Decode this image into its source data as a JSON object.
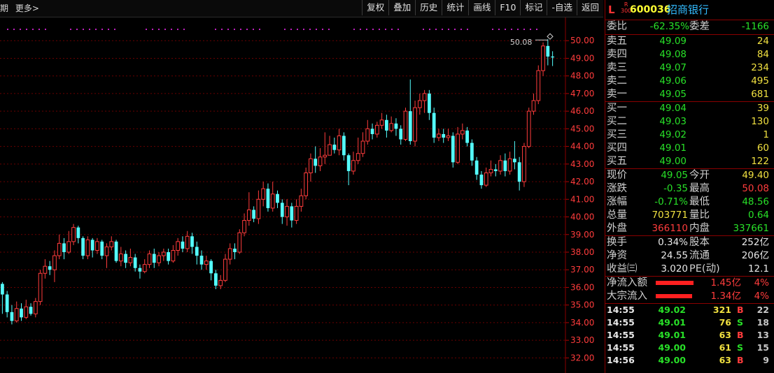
{
  "topbar": {
    "period_label": "期",
    "more_label": "更多>",
    "buttons": [
      "复权",
      "叠加",
      "历史",
      "统计",
      "画线",
      "F10",
      "标记",
      "-自选",
      "返回"
    ]
  },
  "chart_data": {
    "type": "candlestick",
    "ylim": [
      31.5,
      51.0
    ],
    "y_ticks": [
      "50.00",
      "49.00",
      "48.00",
      "47.00",
      "46.00",
      "45.00",
      "44.00",
      "43.00",
      "42.00",
      "41.00",
      "40.00",
      "39.00",
      "38.00",
      "37.00",
      "36.00",
      "35.00",
      "34.00",
      "33.00",
      "32.00"
    ],
    "annotation": "50.08",
    "up_color": "#ff3c3c",
    "down_color": "#54ffff",
    "candles": [
      [
        36.2,
        35.6,
        36.3,
        34.5
      ],
      [
        35.6,
        34.6,
        35.8,
        34.3
      ],
      [
        34.6,
        34.1,
        35.0,
        33.9
      ],
      [
        34.1,
        34.8,
        35.2,
        34.0
      ],
      [
        34.8,
        34.3,
        35.1,
        34.1
      ],
      [
        34.3,
        34.9,
        35.3,
        34.2
      ],
      [
        34.9,
        34.5,
        35.1,
        34.4
      ],
      [
        34.5,
        35.2,
        35.4,
        34.3
      ],
      [
        35.2,
        36.8,
        37.0,
        35.0
      ],
      [
        36.8,
        37.2,
        37.6,
        36.5
      ],
      [
        37.2,
        37.0,
        37.5,
        36.7
      ],
      [
        37.0,
        37.8,
        38.1,
        36.3
      ],
      [
        37.8,
        38.5,
        39.0,
        37.6
      ],
      [
        38.5,
        38.0,
        38.8,
        37.6
      ],
      [
        38.0,
        38.6,
        39.2,
        37.9
      ],
      [
        38.6,
        39.4,
        39.6,
        38.4
      ],
      [
        39.4,
        38.8,
        39.5,
        38.5
      ],
      [
        38.8,
        37.8,
        38.9,
        37.6
      ],
      [
        37.8,
        38.7,
        38.9,
        37.6
      ],
      [
        38.7,
        38.1,
        38.8,
        37.7
      ],
      [
        38.1,
        38.6,
        38.8,
        37.9
      ],
      [
        38.6,
        37.8,
        38.7,
        37.6
      ],
      [
        37.8,
        38.3,
        38.5,
        37.1
      ],
      [
        38.3,
        38.6,
        38.9,
        38.1
      ],
      [
        38.6,
        37.5,
        38.7,
        37.4
      ],
      [
        37.5,
        37.9,
        38.3,
        37.2
      ],
      [
        37.9,
        37.4,
        38.1,
        37.1
      ],
      [
        37.4,
        37.7,
        38.2,
        37.2
      ],
      [
        37.7,
        37.1,
        37.9,
        36.9
      ],
      [
        37.1,
        36.9,
        37.3,
        36.5
      ],
      [
        36.9,
        37.3,
        37.6,
        36.8
      ],
      [
        37.3,
        37.9,
        38.1,
        37.1
      ],
      [
        37.9,
        37.4,
        38.2,
        37.1
      ],
      [
        37.4,
        37.8,
        38.0,
        37.2
      ],
      [
        37.8,
        38.0,
        38.2,
        37.5
      ],
      [
        38.0,
        37.5,
        38.2,
        37.3
      ],
      [
        37.5,
        38.1,
        38.4,
        37.4
      ],
      [
        38.1,
        38.6,
        38.8,
        37.8
      ],
      [
        38.6,
        38.2,
        38.9,
        38.0
      ],
      [
        38.2,
        38.9,
        39.2,
        38.0
      ],
      [
        38.9,
        38.3,
        39.1,
        37.9
      ],
      [
        38.3,
        37.8,
        38.6,
        37.3
      ],
      [
        37.8,
        37.3,
        38.1,
        37.0
      ],
      [
        37.3,
        37.5,
        37.8,
        37.0
      ],
      [
        37.5,
        36.8,
        37.6,
        36.4
      ],
      [
        36.8,
        36.1,
        37.0,
        35.9
      ],
      [
        36.1,
        36.4,
        36.7,
        35.9
      ],
      [
        36.4,
        37.6,
        37.9,
        36.3
      ],
      [
        37.6,
        38.2,
        38.5,
        37.3
      ],
      [
        38.2,
        38.0,
        38.5,
        37.6
      ],
      [
        38.0,
        39.1,
        39.3,
        37.9
      ],
      [
        39.1,
        39.8,
        40.2,
        38.9
      ],
      [
        39.8,
        40.4,
        41.4,
        39.5
      ],
      [
        40.4,
        39.9,
        40.6,
        39.7
      ],
      [
        39.9,
        41.0,
        41.5,
        39.6
      ],
      [
        41.0,
        41.6,
        42.0,
        40.6
      ],
      [
        41.6,
        40.5,
        41.9,
        40.3
      ],
      [
        40.5,
        41.3,
        42.0,
        40.3
      ],
      [
        41.3,
        40.8,
        41.5,
        40.5
      ],
      [
        40.8,
        40.0,
        41.0,
        39.6
      ],
      [
        40.0,
        40.6,
        41.0,
        39.5
      ],
      [
        40.6,
        39.8,
        40.8,
        39.4
      ],
      [
        39.8,
        40.6,
        41.0,
        39.6
      ],
      [
        40.6,
        41.2,
        41.6,
        40.3
      ],
      [
        41.2,
        42.5,
        42.8,
        41.0
      ],
      [
        42.5,
        43.3,
        43.6,
        42.0
      ],
      [
        43.3,
        42.9,
        44.0,
        42.5
      ],
      [
        42.9,
        43.4,
        43.9,
        42.6
      ],
      [
        43.4,
        43.5,
        44.8,
        43.0
      ],
      [
        43.5,
        44.1,
        44.6,
        43.6
      ],
      [
        44.1,
        43.8,
        44.5,
        43.6
      ],
      [
        43.8,
        44.6,
        45.0,
        43.5
      ],
      [
        44.6,
        43.5,
        44.8,
        43.2
      ],
      [
        43.5,
        42.6,
        43.6,
        41.8
      ],
      [
        42.6,
        43.2,
        43.7,
        42.4
      ],
      [
        43.2,
        43.6,
        44.5,
        43.0
      ],
      [
        43.6,
        44.3,
        44.8,
        43.4
      ],
      [
        44.3,
        45.0,
        45.5,
        44.1
      ],
      [
        45.0,
        44.7,
        45.3,
        44.4
      ],
      [
        44.7,
        45.2,
        45.4,
        44.5
      ],
      [
        45.2,
        45.5,
        45.9,
        45.0
      ],
      [
        45.5,
        44.9,
        45.8,
        44.5
      ],
      [
        44.9,
        45.3,
        45.7,
        44.8
      ],
      [
        45.3,
        45.0,
        45.6,
        44.6
      ],
      [
        45.0,
        44.4,
        45.2,
        44.1
      ],
      [
        44.4,
        46.0,
        46.2,
        44.3
      ],
      [
        46.0,
        44.3,
        47.8,
        44.1
      ],
      [
        44.3,
        46.2,
        46.6,
        44.0
      ],
      [
        46.2,
        46.6,
        47.0,
        45.8
      ],
      [
        46.6,
        47.0,
        47.2,
        45.9
      ],
      [
        47.0,
        45.9,
        47.2,
        45.5
      ],
      [
        45.9,
        44.5,
        46.2,
        44.2
      ],
      [
        44.5,
        44.7,
        45.0,
        44.3
      ],
      [
        44.7,
        44.5,
        45.0,
        44.2
      ],
      [
        44.5,
        44.6,
        45.0,
        44.3
      ],
      [
        44.6,
        43.1,
        44.8,
        42.8
      ],
      [
        43.1,
        44.7,
        45.1,
        43.0
      ],
      [
        44.7,
        44.9,
        45.3,
        44.4
      ],
      [
        44.9,
        44.2,
        45.1,
        44.0
      ],
      [
        44.2,
        43.2,
        44.4,
        42.9
      ],
      [
        43.2,
        42.4,
        43.4,
        42.1
      ],
      [
        42.4,
        41.8,
        42.6,
        41.6
      ],
      [
        41.8,
        42.5,
        42.8,
        41.7
      ],
      [
        42.5,
        42.7,
        43.2,
        42.3
      ],
      [
        42.7,
        42.6,
        43.0,
        42.3
      ],
      [
        42.6,
        43.2,
        43.5,
        42.4
      ],
      [
        43.2,
        42.6,
        43.6,
        42.3
      ],
      [
        42.6,
        43.3,
        43.7,
        42.4
      ],
      [
        43.3,
        43.1,
        44.3,
        42.7
      ],
      [
        43.1,
        42.0,
        43.4,
        41.5
      ],
      [
        42.0,
        44.0,
        44.2,
        41.7
      ],
      [
        44.0,
        46.0,
        46.2,
        43.9
      ],
      [
        46.0,
        46.6,
        47.0,
        45.8
      ],
      [
        46.6,
        48.3,
        48.6,
        46.4
      ],
      [
        48.3,
        49.7,
        49.9,
        48.0
      ],
      [
        49.7,
        49.1,
        50.08,
        48.6
      ],
      [
        49.1,
        49.05,
        49.4,
        48.56
      ]
    ]
  },
  "quote": {
    "code": "600036",
    "name": "招商银行",
    "letter": "L",
    "small_top": "R",
    "small_bottom": "300",
    "weibi_label": "委比",
    "weibi": "-62.35%",
    "weicha_label": "委差",
    "weicha": "-1166",
    "asks": [
      {
        "label": "卖五",
        "price": "49.09",
        "vol": "24"
      },
      {
        "label": "卖四",
        "price": "49.08",
        "vol": "84"
      },
      {
        "label": "卖三",
        "price": "49.07",
        "vol": "234"
      },
      {
        "label": "卖二",
        "price": "49.06",
        "vol": "495"
      },
      {
        "label": "卖一",
        "price": "49.05",
        "vol": "681"
      }
    ],
    "bids": [
      {
        "label": "买一",
        "price": "49.04",
        "vol": "39"
      },
      {
        "label": "买二",
        "price": "49.03",
        "vol": "130"
      },
      {
        "label": "买三",
        "price": "49.02",
        "vol": "1"
      },
      {
        "label": "买四",
        "price": "49.01",
        "vol": "60"
      },
      {
        "label": "买五",
        "price": "49.00",
        "vol": "122"
      }
    ],
    "stats1": [
      {
        "l1": "现价",
        "v1": "49.05",
        "l2": "今开",
        "v2": "49.40"
      },
      {
        "l1": "涨跌",
        "v1": "-0.35",
        "l2": "最高",
        "v2": "50.08"
      },
      {
        "l1": "涨幅",
        "v1": "-0.71%",
        "l2": "最低",
        "v2": "48.56"
      },
      {
        "l1": "总量",
        "v1": "703771",
        "l2": "量比",
        "v2": "0.64"
      },
      {
        "l1": "外盘",
        "v1": "366110",
        "l2": "内盘",
        "v2": "337661"
      }
    ],
    "stats2": [
      {
        "l1": "换手",
        "v1": "0.34%",
        "l2": "股本",
        "v2": "252亿"
      },
      {
        "l1": "净资",
        "v1": "24.55",
        "l2": "流通",
        "v2": "206亿"
      },
      {
        "l1": "收益㈢",
        "v1": "3.020",
        "l2": "PE(动)",
        "v2": "12.1"
      }
    ],
    "flows": [
      {
        "label": "净流入额",
        "amount": "1.45亿",
        "pct": "4%"
      },
      {
        "label": "大宗流入",
        "amount": "1.34亿",
        "pct": "4%"
      }
    ],
    "ticks": [
      {
        "time": "14:55",
        "price": "49.02",
        "vol": "321",
        "dir": "B",
        "n": "22"
      },
      {
        "time": "14:55",
        "price": "49.01",
        "vol": "76",
        "dir": "S",
        "n": "18"
      },
      {
        "time": "14:55",
        "price": "49.01",
        "vol": "63",
        "dir": "B",
        "n": "13"
      },
      {
        "time": "14:55",
        "price": "49.00",
        "vol": "61",
        "dir": "S",
        "n": "15"
      },
      {
        "time": "14:56",
        "price": "49.00",
        "vol": "63",
        "dir": "B",
        "n": "9"
      }
    ]
  }
}
